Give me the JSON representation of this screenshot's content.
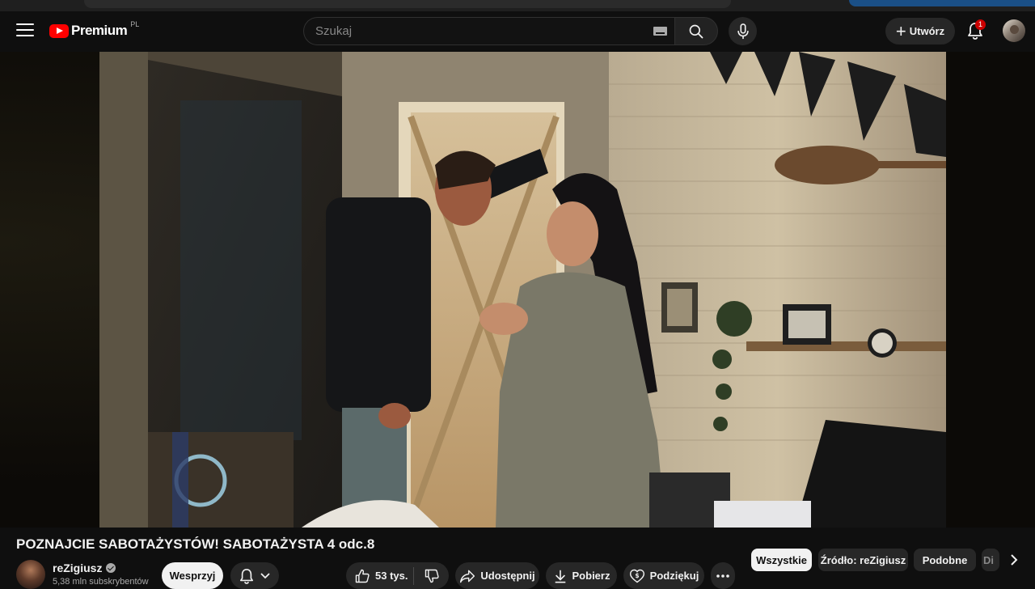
{
  "header": {
    "logo_text": "Premium",
    "logo_region": "PL",
    "search_placeholder": "Szukaj",
    "create_label": "Utwórz",
    "notification_count": "1"
  },
  "video": {
    "title": "POZNAJCIE SABOTAŻYSTÓW! SABOTAŻYSTA 4 odc.8"
  },
  "channel": {
    "name": "reZigiusz",
    "subscribers": "5,38 mln subskrybentów",
    "support_label": "Wesprzyj"
  },
  "actions": {
    "likes": "53 tys.",
    "share_label": "Udostępnij",
    "download_label": "Pobierz",
    "thanks_label": "Podziękuj"
  },
  "chips": {
    "all": "Wszystkie",
    "source": "Źródło: reZigiusz",
    "similar": "Podobne",
    "clipped": "Di"
  },
  "colors": {
    "brand_red": "#ff0000",
    "badge_red": "#cc0000",
    "background": "#0f0f0f",
    "pill_bg": "#272727"
  }
}
